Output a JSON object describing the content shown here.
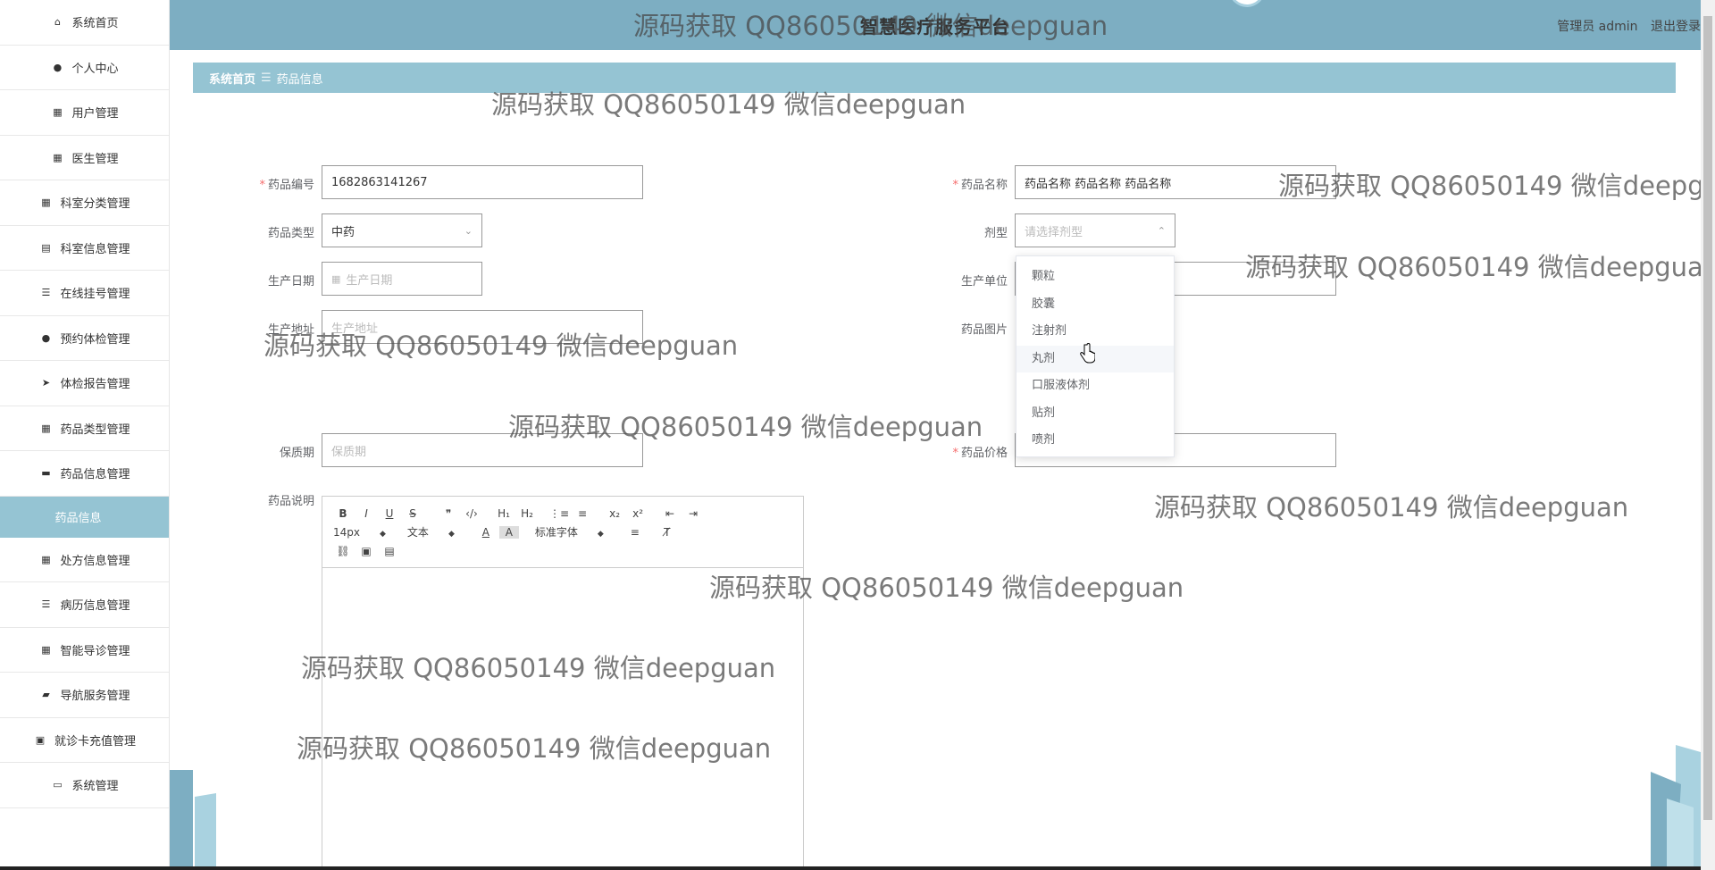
{
  "app": {
    "title": "智慧医疗服务平台",
    "admin_label": "管理员 admin",
    "logout_label": "退出登录"
  },
  "sidebar": {
    "items": [
      {
        "label": "系统首页",
        "icon": "home-icon"
      },
      {
        "label": "个人中心",
        "icon": "user-icon"
      },
      {
        "label": "用户管理",
        "icon": "grid-icon"
      },
      {
        "label": "医生管理",
        "icon": "grid-icon"
      },
      {
        "label": "科室分类管理",
        "icon": "grid-icon"
      },
      {
        "label": "科室信息管理",
        "icon": "clipboard-icon"
      },
      {
        "label": "在线挂号管理",
        "icon": "list-icon"
      },
      {
        "label": "预约体检管理",
        "icon": "user-icon"
      },
      {
        "label": "体检报告管理",
        "icon": "send-icon"
      },
      {
        "label": "药品类型管理",
        "icon": "grid-icon"
      },
      {
        "label": "药品信息管理",
        "icon": "monitor-icon"
      },
      {
        "label": "药品信息",
        "icon": "",
        "active": true
      },
      {
        "label": "处方信息管理",
        "icon": "grid-icon"
      },
      {
        "label": "病历信息管理",
        "icon": "list-icon"
      },
      {
        "label": "智能导诊管理",
        "icon": "grid-icon"
      },
      {
        "label": "导航服务管理",
        "icon": "ticket-icon"
      },
      {
        "label": "就诊卡充值管理",
        "icon": "briefcase-icon"
      },
      {
        "label": "系统管理",
        "icon": "drive-icon"
      }
    ]
  },
  "breadcrumb": {
    "home": "系统首页",
    "separator": "☰",
    "current": "药品信息"
  },
  "form": {
    "drug_no": {
      "label": "药品编号",
      "value": "1682863141267",
      "required": true
    },
    "drug_name": {
      "label": "药品名称",
      "value": "药品名称 药品名称 药品名称",
      "required": true
    },
    "drug_type": {
      "label": "药品类型",
      "value": "中药"
    },
    "dosage_form": {
      "label": "剂型",
      "placeholder": "请选择剂型"
    },
    "production_date": {
      "label": "生产日期",
      "placeholder": "生产日期"
    },
    "manufacturer": {
      "label": "生产单位"
    },
    "production_address": {
      "label": "生产地址",
      "placeholder": "生产地址"
    },
    "drug_image": {
      "label": "药品图片"
    },
    "shelf_life": {
      "label": "保质期",
      "placeholder": "保质期"
    },
    "price": {
      "label": "药品价格",
      "required": true
    },
    "description": {
      "label": "药品说明"
    }
  },
  "dosage_options": [
    "颗粒",
    "胶囊",
    "注射剂",
    "丸剂",
    "口服液体剂",
    "贴剂",
    "喷剂"
  ],
  "editor": {
    "font_size": "14px",
    "text_style": "文本",
    "font_family": "标准字体"
  },
  "watermark": "源码获取 QQ86050149 微信deepguan",
  "colors": {
    "header": "#7daec2",
    "breadcrumb": "#95c4d3",
    "active_nav": "#95c4d3"
  }
}
